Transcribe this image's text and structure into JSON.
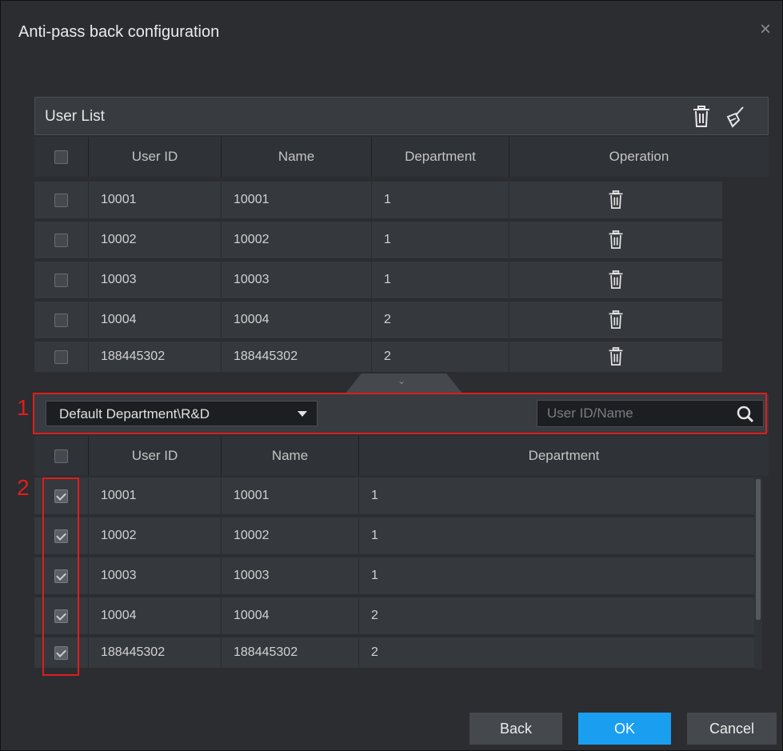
{
  "dialog": {
    "title": "Anti-pass back configuration",
    "close_glyph": "×"
  },
  "user_list": {
    "title": "User List",
    "header_icons": [
      "trash-icon",
      "broom-clear-icon"
    ],
    "columns": [
      "User ID",
      "Name",
      "Department",
      "Operation"
    ],
    "rows": [
      {
        "user_id": "10001",
        "name": "10001",
        "department": "1"
      },
      {
        "user_id": "10002",
        "name": "10002",
        "department": "1"
      },
      {
        "user_id": "10003",
        "name": "10003",
        "department": "1"
      },
      {
        "user_id": "10004",
        "name": "10004",
        "department": "2"
      },
      {
        "user_id": "188445302",
        "name": "188445302",
        "department": "2"
      }
    ]
  },
  "collapse_glyph": "⌄",
  "filter": {
    "department_selected": "Default Department\\R&D",
    "search_placeholder": "User ID/Name"
  },
  "selection_list": {
    "columns": [
      "User ID",
      "Name",
      "Department"
    ],
    "rows": [
      {
        "user_id": "10001",
        "name": "10001",
        "department": "1",
        "checked": true
      },
      {
        "user_id": "10002",
        "name": "10002",
        "department": "1",
        "checked": true
      },
      {
        "user_id": "10003",
        "name": "10003",
        "department": "1",
        "checked": true
      },
      {
        "user_id": "10004",
        "name": "10004",
        "department": "2",
        "checked": true
      },
      {
        "user_id": "188445302",
        "name": "188445302",
        "department": "2",
        "checked": true
      }
    ]
  },
  "annotations": {
    "marker_1": "1",
    "marker_2": "2",
    "color": "#e01d1d"
  },
  "buttons": {
    "back": "Back",
    "ok": "OK",
    "cancel": "Cancel"
  },
  "colors": {
    "primary": "#1a9ef0",
    "background": "#2b2d31"
  }
}
